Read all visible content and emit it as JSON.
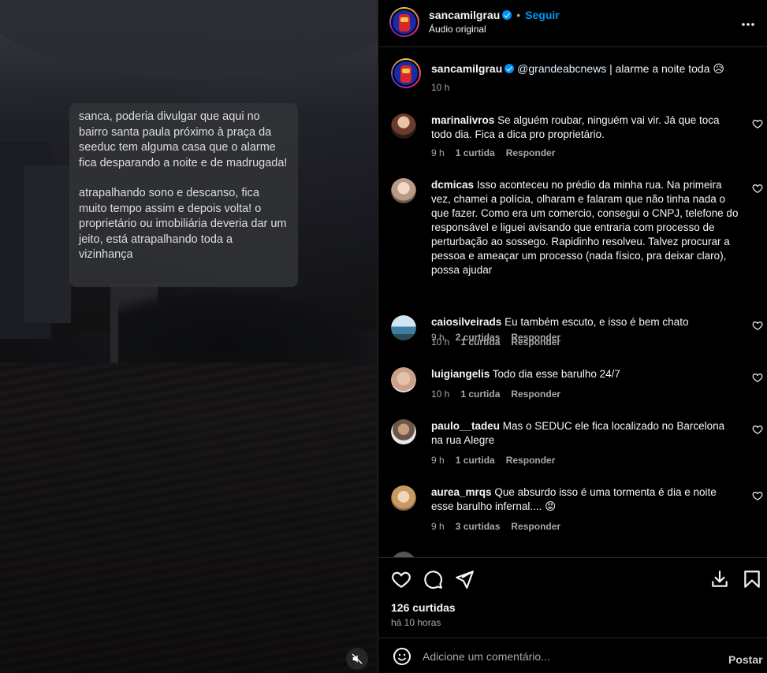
{
  "video": {
    "message_paragraphs": [
      "sanca, poderia divulgar que aqui no bairro santa paula próximo à praça da seeduc tem alguma casa que o alarme fica desparando a noite e de madrugada!",
      "atrapalhando sono e descanso, fica muito tempo assim e depois volta! o proprietário ou imobiliária deveria dar um jeito, está atrapalhando toda a vizinhança"
    ],
    "mute_icon": "speaker-muted-icon"
  },
  "header": {
    "username": "sancamilgrau",
    "follow_label": "Seguir",
    "audio_label": "Áudio original",
    "more_icon": "more-horizontal-icon"
  },
  "caption": {
    "username": "sancamilgrau",
    "mention": "@grandeabcnews",
    "text": " | alarme a noite toda 😥",
    "time": "10 h"
  },
  "comments": [
    {
      "username": "marinalivros",
      "text": "Se alguém roubar, ninguém vai vir. Já que toca todo dia. Fica a dica pro proprietário.",
      "time": "9 h",
      "likes": "1 curtida",
      "reply": "Responder",
      "avatar_color": "#7a4a3a"
    },
    {
      "username": "dcmicas",
      "text": "Isso aconteceu no prédio da minha rua. Na primeira vez, chamei a polícia, olharam e falaram que não tinha nada o que fazer. Como era um comercio, consegui o CNPJ, telefone do responsável e liguei avisando que entraria com processo de perturbação ao sossego. Rapidinho resolveu. Talvez procurar a pessoa e ameaçar um processo (nada físico, pra deixar claro), possa ajudar",
      "time": "9 h",
      "likes": "2 curtidas",
      "reply": "Responder",
      "avatar_color": "#c9a98a"
    },
    {
      "username": "caiosilveirads",
      "text": "Eu também escuto, e isso é bem chato",
      "time": "10 h",
      "likes": "1 curtida",
      "reply": "Responder",
      "avatar_color": "#5d8fa8"
    },
    {
      "username": "luigiangelis",
      "text": "Todo dia esse barulho 24/7",
      "time": "10 h",
      "likes": "1 curtida",
      "reply": "Responder",
      "avatar_color": "#d8b49a"
    },
    {
      "username": "paulo__tadeu",
      "text": "Mas o SEDUC ele fica localizado no Barcelona na rua Alegre",
      "time": "9 h",
      "likes": "1 curtida",
      "reply": "Responder",
      "avatar_color": "#8a7060"
    },
    {
      "username": "aurea_mrqs",
      "text": "Que absurdo isso é uma tormenta é dia e noite esse barulho infernal.... 😡",
      "time": "9 h",
      "likes": "3 curtidas",
      "reply": "Responder",
      "avatar_color": "#c8a070"
    }
  ],
  "actions": {
    "like_icon": "heart-icon",
    "comment_icon": "comment-icon",
    "share_icon": "share-icon",
    "save_icon": "save-icon",
    "download_icon": "download-icon",
    "likes_count": "126 curtidas",
    "posted_ago": "há 10 horas"
  },
  "add_comment": {
    "placeholder": "Adicione um comentário...",
    "post_label": "Postar",
    "emoji_icon": "emoji-icon"
  }
}
